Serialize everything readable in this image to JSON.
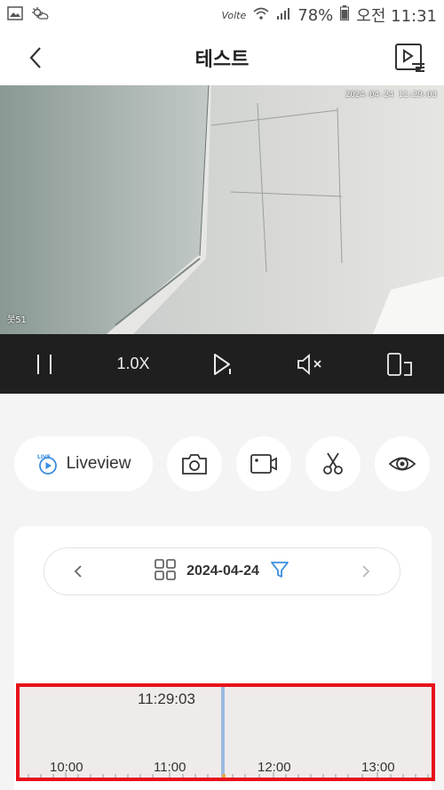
{
  "status_bar": {
    "left_icons": [
      "gallery-icon",
      "weather-icon"
    ],
    "network": "Volte",
    "battery": "78%",
    "time": "오전 11:31"
  },
  "header": {
    "title": "테스트"
  },
  "video": {
    "timestamp": "2024-04-24 11:29:03",
    "osd_label": "봇51"
  },
  "controls": {
    "speed": "1.0X"
  },
  "actions": {
    "liveview_label": "Liveview",
    "live_badge": "LIVE"
  },
  "date_selector": {
    "date": "2024-04-24"
  },
  "timeline": {
    "current_time": "11:29:03",
    "hour_labels": [
      "10:00",
      "11:00",
      "12:00",
      "13:00"
    ]
  },
  "colors": {
    "accent": "#3b8ee0",
    "highlight": "#e8101a"
  }
}
